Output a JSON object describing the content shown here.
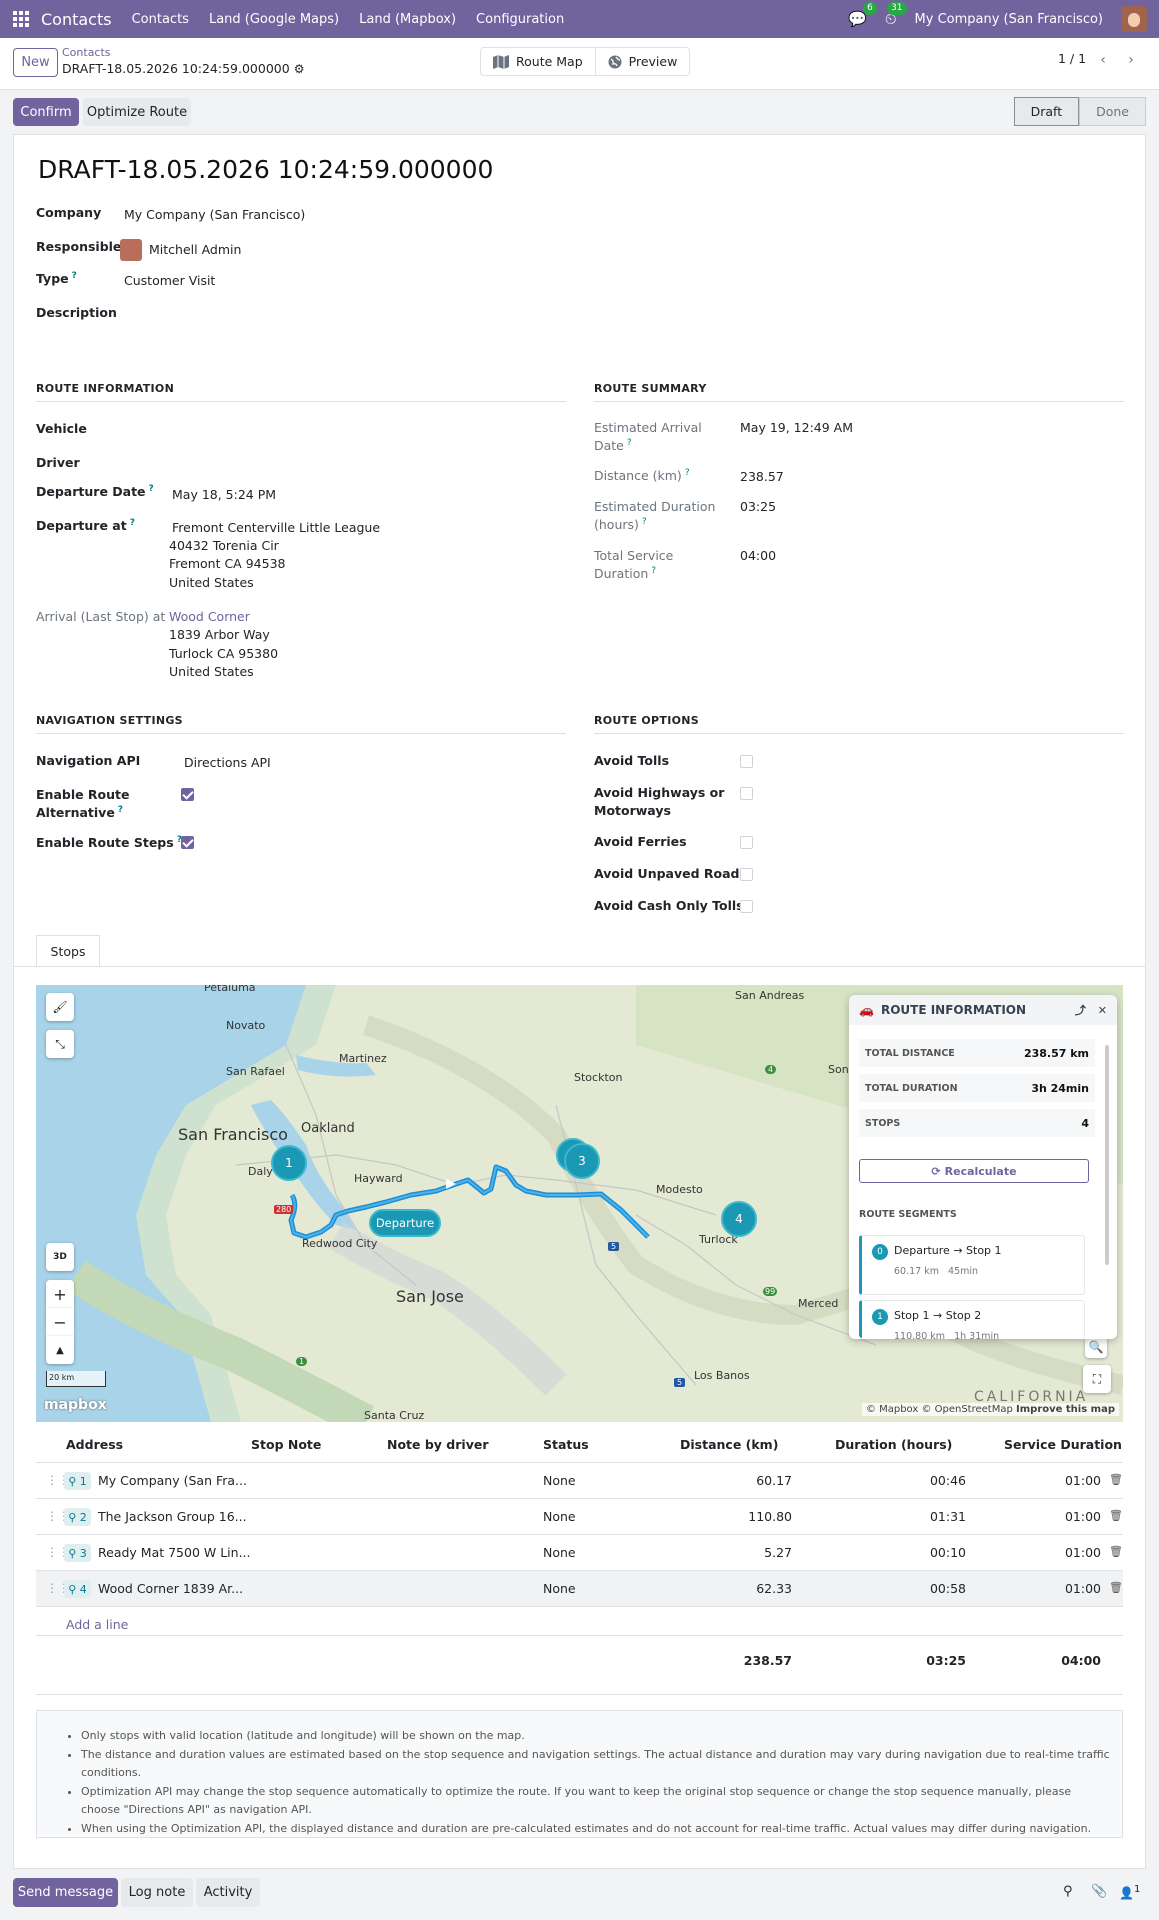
{
  "navbar": {
    "brand": "Contacts",
    "menus": [
      "Contacts",
      "Land (Google Maps)",
      "Land (Mapbox)",
      "Configuration"
    ],
    "chat_count": "6",
    "activity_count": "31",
    "company": "My Company (San Francisco)"
  },
  "control": {
    "new_label": "New",
    "breadcrumb_parent": "Contacts",
    "breadcrumb_current": "DRAFT-18.05.2026 10:24:59.000000",
    "route_map_label": "Route Map",
    "preview_label": "Preview",
    "pager": "1 / 1"
  },
  "status": {
    "confirm_label": "Confirm",
    "optimize_label": "Optimize Route",
    "stages": [
      "Draft",
      "Done"
    ],
    "active_stage": "Draft"
  },
  "form": {
    "title": "DRAFT-18.05.2026 10:24:59.000000",
    "company_label": "Company",
    "company": "My Company (San Francisco)",
    "responsible_label": "Responsible",
    "responsible": "Mitchell Admin",
    "type_label": "Type",
    "type": "Customer Visit",
    "description_label": "Description"
  },
  "route_info": {
    "heading": "ROUTE INFORMATION",
    "vehicle_label": "Vehicle",
    "driver_label": "Driver",
    "departure_date_label": "Departure Date",
    "departure_date": "May 18, 5:24 PM",
    "departure_at_label": "Departure at",
    "departure_at": [
      "Fremont Centerville Little League",
      "40432 Torenia Cir",
      "Fremont CA 94538",
      "United States"
    ],
    "arrival_label": "Arrival (Last Stop) at",
    "arrival": [
      "Wood Corner",
      "1839 Arbor Way",
      "Turlock CA 95380",
      "United States"
    ]
  },
  "route_summary": {
    "heading": "ROUTE SUMMARY",
    "eta_label_1": "Estimated Arrival",
    "eta_label_2": "Date",
    "eta": "May 19, 12:49 AM",
    "distance_label": "Distance (km)",
    "distance": "238.57",
    "duration_label_1": "Estimated Duration",
    "duration_label_2": "(hours)",
    "duration": "03:25",
    "service_label_1": "Total Service",
    "service_label_2": "Duration",
    "service": "04:00"
  },
  "nav_settings": {
    "heading": "NAVIGATION SETTINGS",
    "api_label": "Navigation API",
    "api": "Directions API",
    "alt_label_1": "Enable Route",
    "alt_label_2": "Alternative",
    "alt_checked": true,
    "steps_label": "Enable Route Steps",
    "steps_checked": true
  },
  "route_options": {
    "heading": "ROUTE OPTIONS",
    "tolls": "Avoid Tolls",
    "highways_1": "Avoid Highways or",
    "highways_2": "Motorways",
    "ferries": "Avoid Ferries",
    "unpaved": "Avoid Unpaved Roads",
    "cash": "Avoid Cash Only Tolls"
  },
  "tabs": {
    "stops": "Stops"
  },
  "map": {
    "labels": {
      "petaluma": "Petaluma",
      "novato": "Novato",
      "martinez": "Martinez",
      "san_rafael": "San Rafael",
      "stockton": "Stockton",
      "san_andreas": "San Andreas",
      "sonora": "Sonor",
      "san_francisco": "San Francisco",
      "oakland": "Oakland",
      "daly": "Daly",
      "hayward": "Hayward",
      "modesto": "Modesto",
      "redwood": "Redwood City",
      "turlock": "Turlock",
      "san_jose": "San Jose",
      "merced": "Merced",
      "los_banos": "Los Banos",
      "santa_cruz": "Santa Cruz",
      "california": "CALIFORNIA"
    },
    "shields": {
      "h280": "280",
      "h5a": "5",
      "h5b": "5",
      "h4": "4",
      "h99": "99",
      "h1": "1"
    },
    "pins": [
      "1",
      "3",
      "4"
    ],
    "departure_label": "Departure",
    "btn_3d": "3D",
    "scale": "20 km",
    "logo": "mapbox",
    "attribution": "© Mapbox © OpenStreetMap",
    "improve": "Improve this map",
    "info": {
      "title": "ROUTE INFORMATION",
      "total_distance_label": "TOTAL DISTANCE",
      "total_distance": "238.57 km",
      "total_duration_label": "TOTAL DURATION",
      "total_duration": "3h 24min",
      "stops_label": "STOPS",
      "stops": "4",
      "recalculate": "Recalculate",
      "segments_heading": "ROUTE SEGMENTS",
      "segments": [
        {
          "n": "0",
          "name": "Departure → Stop 1",
          "dist": "60.17 km",
          "dur": "45min"
        },
        {
          "n": "1",
          "name": "Stop 1 → Stop 2",
          "dist": "110.80 km",
          "dur": "1h 31min"
        }
      ]
    }
  },
  "table": {
    "headers": [
      "Address",
      "Stop Note",
      "Note by driver",
      "Status",
      "Distance (km)",
      "Duration (hours)",
      "Service Duration"
    ],
    "rows": [
      {
        "seq": "1",
        "address": "My Company (San Fra...",
        "status": "None",
        "distance": "60.17",
        "duration": "00:46",
        "service": "01:00"
      },
      {
        "seq": "2",
        "address": "The Jackson Group 16...",
        "status": "None",
        "distance": "110.80",
        "duration": "01:31",
        "service": "01:00"
      },
      {
        "seq": "3",
        "address": "Ready Mat 7500 W Lin...",
        "status": "None",
        "distance": "5.27",
        "duration": "00:10",
        "service": "01:00"
      },
      {
        "seq": "4",
        "address": "Wood Corner 1839 Ar...",
        "status": "None",
        "distance": "62.33",
        "duration": "00:58",
        "service": "01:00"
      }
    ],
    "add_line": "Add a line",
    "totals": {
      "distance": "238.57",
      "duration": "03:25",
      "service": "04:00"
    }
  },
  "notes": [
    "Only stops with valid location (latitude and longitude) will be shown on the map.",
    "The distance and duration values are estimated based on the stop sequence and navigation settings. The actual distance and duration may vary during navigation due to real-time traffic conditions.",
    "Optimization API may change the stop sequence automatically to optimize the route. If you want to keep the original stop sequence or change the stop sequence manually, please choose \"Directions API\" as navigation API.",
    "When using the Optimization API, the displayed distance and duration are pre-calculated estimates and do not account for real-time traffic. Actual values may differ during navigation."
  ],
  "chatter": {
    "send_message": "Send message",
    "log_note": "Log note",
    "activity": "Activity",
    "followers": "1"
  }
}
